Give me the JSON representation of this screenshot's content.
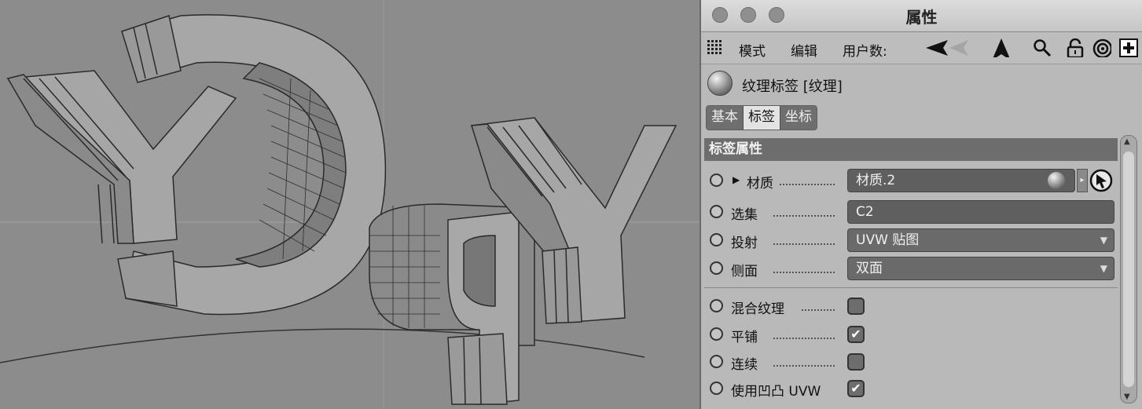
{
  "window": {
    "title": "属性"
  },
  "toolbar": {
    "menus": [
      "模式",
      "编辑",
      "用户数:"
    ],
    "icons": [
      "grid-icon",
      "back-arrow-icon",
      "up-arrow-icon",
      "search-icon",
      "lock-icon",
      "target-icon",
      "add-panel-icon"
    ]
  },
  "object": {
    "title": "纹理标签 [纹理]"
  },
  "tabs": {
    "basic": "基本",
    "tag": "标签",
    "coords": "坐标"
  },
  "section": {
    "title": "标签属性"
  },
  "properties": {
    "material": {
      "label": "材质",
      "value": "材质.2"
    },
    "selection": {
      "label": "选集",
      "value": "C2"
    },
    "projection": {
      "label": "投射",
      "value": "UVW 贴图"
    },
    "side": {
      "label": "侧面",
      "value": "双面"
    },
    "mix_textures": {
      "label": "混合纹理",
      "checked": false
    },
    "tile": {
      "label": "平铺",
      "checked": true
    },
    "seamless": {
      "label": "连续",
      "checked": false
    },
    "use_bump_uvw": {
      "label": "使用凹凸 UVW",
      "checked": true
    }
  },
  "colors": {
    "viewport_bg": "#8c8c8c",
    "panel_bg": "#b9b9b9",
    "field_bg": "#5f5f5f",
    "section_bg": "#6d6d6d"
  }
}
